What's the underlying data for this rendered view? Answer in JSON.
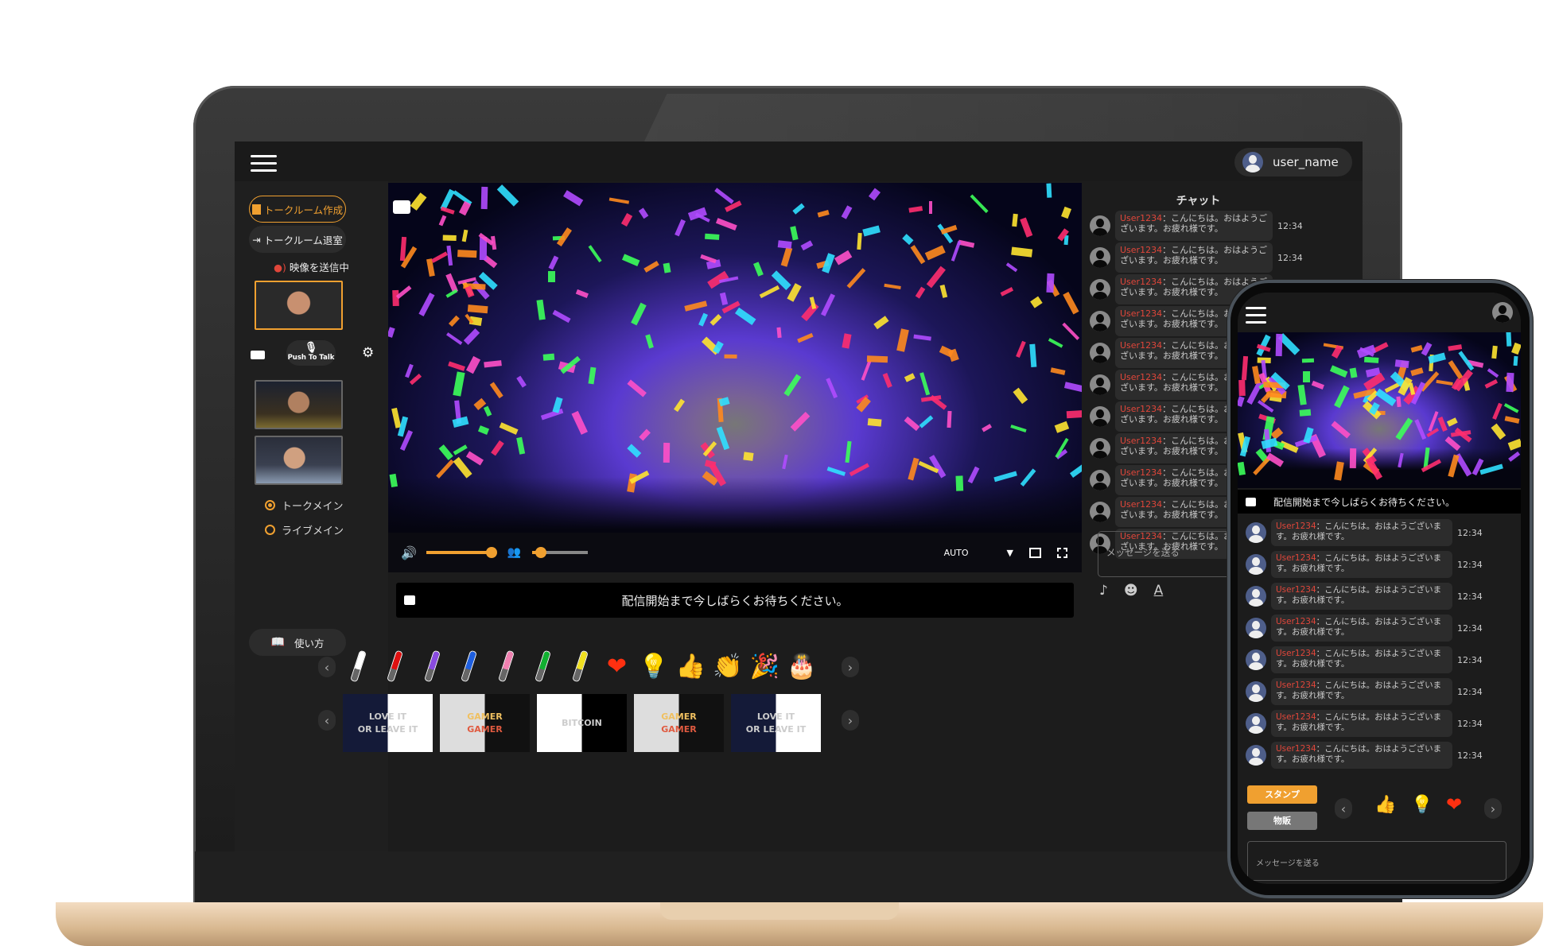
{
  "header": {
    "user_name": "user_name"
  },
  "sidebar": {
    "create_room": "トークルーム作成",
    "leave_room": "トークルーム退室",
    "sending_status": "映像を送信中",
    "push_to_talk": "Push To Talk",
    "layout_options": [
      {
        "label": "トークメイン",
        "selected": true
      },
      {
        "label": "ライブメイン",
        "selected": false
      }
    ],
    "howto": "使い方"
  },
  "player": {
    "volume_percent": 100,
    "participants_percent": 15,
    "quality": "AUTO",
    "notice": "配信開始まで今しばらくお待ちください。"
  },
  "stamps": [
    "white-penlight",
    "red-penlight",
    "purple-penlight",
    "blue-penlight",
    "pink-penlight",
    "green-penlight",
    "yellow-penlight",
    "heart",
    "lightbulb",
    "thumbs-up",
    "clapping-hands",
    "party-popper",
    "birthday-cake"
  ],
  "penlight_colors": [
    "#ffffff",
    "#e01010",
    "#8a4be0",
    "#1e5fe0",
    "#f080b0",
    "#10b030",
    "#f0e020"
  ],
  "goods": [
    {
      "lines": [
        "LOVE IT",
        "OR LEAVE IT"
      ]
    },
    {
      "lines": [
        "GAMER",
        "GAMER"
      ]
    },
    {
      "lines": [
        "BITCOIN"
      ]
    },
    {
      "lines": [
        "GAMER",
        "GAMER"
      ]
    },
    {
      "lines": [
        "LOVE IT",
        "OR LEAVE IT"
      ]
    }
  ],
  "chat": {
    "title": "チャット",
    "messages": [
      {
        "user": "User1234",
        "text": "：こんにちは。おはようございます。お疲れ様です。",
        "time": "12:34"
      },
      {
        "user": "User1234",
        "text": "：こんにちは。おはようございます。お疲れ様です。",
        "time": "12:34"
      },
      {
        "user": "User1234",
        "text": "：こんにちは。おはようございます。お疲れ様です。",
        "time": "12:34"
      },
      {
        "user": "User1234",
        "text": "：こんにちは。おはようございます。お疲れ様です。",
        "time": "12:34"
      },
      {
        "user": "User1234",
        "text": "：こんにちは。おはようございます。お疲れ様です。",
        "time": "12:34"
      },
      {
        "user": "User1234",
        "text": "：こんにちは。おはようございます。お疲れ様です。",
        "time": "12:34"
      },
      {
        "user": "User1234",
        "text": "：こんにちは。おはようございます。お疲れ様です。",
        "time": "12:34"
      },
      {
        "user": "User1234",
        "text": "：こんにちは。おはようございます。お疲れ様です。",
        "time": "12:34"
      },
      {
        "user": "User1234",
        "text": "：こんにちは。おはようございます。お疲れ様です。",
        "time": "12:34"
      },
      {
        "user": "User1234",
        "text": "：こんにちは。おはようございます。お疲れ様です。",
        "time": "12:34"
      },
      {
        "user": "User1234",
        "text": "：こんにちは。おはようございます。お疲れ様です。",
        "time": "12:34"
      }
    ],
    "input_placeholder": "メッセージを送る"
  },
  "phone": {
    "notice": "配信開始まで今しばらくお待ちください。",
    "stamp_tab": "スタンプ",
    "goods_tab": "物販",
    "input_placeholder": "メッセージを送る",
    "messages_count_visible": 8,
    "stamps": [
      "thumbs-up",
      "lightbulb",
      "heart"
    ]
  },
  "colors": {
    "accent": "#f0a030",
    "username": "#e0463a",
    "background": "#1c1c1c"
  }
}
